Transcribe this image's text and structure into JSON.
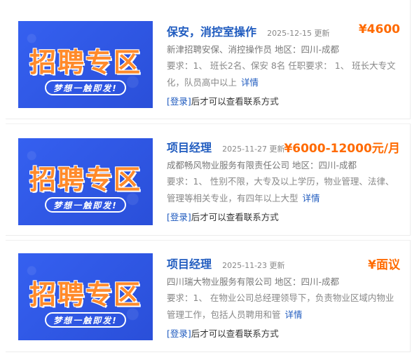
{
  "banner": {
    "title": "招聘专区",
    "slogan": "梦想一触即发!"
  },
  "jobs": [
    {
      "title": "保安，消控室操作",
      "date": "2025-12-15 更新",
      "salary": "¥4600",
      "company": "新津招聘安保、消控操作员 地区：四川-成都",
      "requirement": "要求：1、 班长2名、保安 8名 任职要求： 1、 班长大专文化，队员高中以上",
      "detail": "详情",
      "login": "[登录]",
      "login_suffix": "后才可以查看联系方式"
    },
    {
      "title": "项目经理",
      "date": "2025-11-27 更新",
      "salary": "¥6000-12000元/月",
      "company": "成都畅风物业服务有限责任公司 地区：四川-成都",
      "requirement": "要求：1、 性别不限，大专及以上学历，物业管理、法律、管理等相关专业，有四年以上大型",
      "detail": "详情",
      "login": "[登录]",
      "login_suffix": "后才可以查看联系方式"
    },
    {
      "title": "项目经理",
      "date": "2025-11-23 更新",
      "salary": "¥面议",
      "company": "四川瑞大物业服务有限公司 地区：四川-成都",
      "requirement": "要求：1、 在物业公司总经理领导下，负责物业区域内物业管理工作，包括人员聘用和管",
      "detail": "详情",
      "login": "[登录]",
      "login_suffix": "后才可以查看联系方式"
    }
  ],
  "colors": {
    "link": "#1f5bbf",
    "salary": "#ff6a00",
    "banner_bg": "#2f57e8",
    "banner_title": "#ff8a2b"
  }
}
